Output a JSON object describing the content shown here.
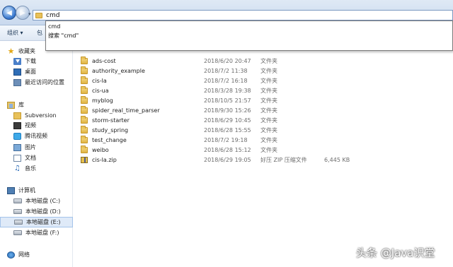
{
  "address_bar": {
    "value": "cmd"
  },
  "toolbar": {
    "organize_label": "组织 ▾",
    "more_label": "包"
  },
  "autocomplete": {
    "items": [
      "cmd",
      "搜索 \"cmd\""
    ]
  },
  "nav_pane": {
    "favorites": {
      "header": "收藏夹",
      "items": [
        {
          "label": "下载",
          "icon": "download-folder-icon"
        },
        {
          "label": "桌面",
          "icon": "desktop-icon"
        },
        {
          "label": "最近访问的位置",
          "icon": "recent-places-icon"
        }
      ]
    },
    "libraries": {
      "header": "库",
      "items": [
        {
          "label": "Subversion",
          "icon": "svn-folder-icon"
        },
        {
          "label": "视频",
          "icon": "video-library-icon"
        },
        {
          "label": "腾讯视频",
          "icon": "tencent-video-icon"
        },
        {
          "label": "图片",
          "icon": "pictures-library-icon"
        },
        {
          "label": "文档",
          "icon": "documents-library-icon"
        },
        {
          "label": "音乐",
          "icon": "music-library-icon"
        }
      ]
    },
    "computer": {
      "header": "计算机",
      "drives": [
        {
          "label": "本地磁盘 (C:)",
          "selected": false
        },
        {
          "label": "本地磁盘 (D:)",
          "selected": false
        },
        {
          "label": "本地磁盘 (E:)",
          "selected": true
        },
        {
          "label": "本地磁盘 (F:)",
          "selected": false
        }
      ]
    },
    "network": {
      "header": "网络"
    }
  },
  "files": [
    {
      "name": "ads-cost",
      "date": "2018/6/20 20:47",
      "type": "文件夹",
      "size": "",
      "kind": "folder"
    },
    {
      "name": "authority_example",
      "date": "2018/7/2 11:38",
      "type": "文件夹",
      "size": "",
      "kind": "folder"
    },
    {
      "name": "cis-la",
      "date": "2018/7/2 16:18",
      "type": "文件夹",
      "size": "",
      "kind": "folder"
    },
    {
      "name": "cis-ua",
      "date": "2018/3/28 19:38",
      "type": "文件夹",
      "size": "",
      "kind": "folder"
    },
    {
      "name": "myblog",
      "date": "2018/10/5 21:57",
      "type": "文件夹",
      "size": "",
      "kind": "folder"
    },
    {
      "name": "spider_real_time_parser",
      "date": "2018/9/30 15:26",
      "type": "文件夹",
      "size": "",
      "kind": "folder"
    },
    {
      "name": "storm-starter",
      "date": "2018/6/29 10:45",
      "type": "文件夹",
      "size": "",
      "kind": "folder"
    },
    {
      "name": "study_spring",
      "date": "2018/6/28 15:55",
      "type": "文件夹",
      "size": "",
      "kind": "folder"
    },
    {
      "name": "test_change",
      "date": "2018/7/2 19:18",
      "type": "文件夹",
      "size": "",
      "kind": "folder"
    },
    {
      "name": "weibo",
      "date": "2018/6/28 15:12",
      "type": "文件夹",
      "size": "",
      "kind": "folder"
    },
    {
      "name": "cis-la.zip",
      "date": "2018/6/29 19:05",
      "type": "好压 ZIP 压缩文件",
      "size": "6,445 KB",
      "kind": "zip"
    }
  ],
  "watermark": "头条 @Java识堂"
}
